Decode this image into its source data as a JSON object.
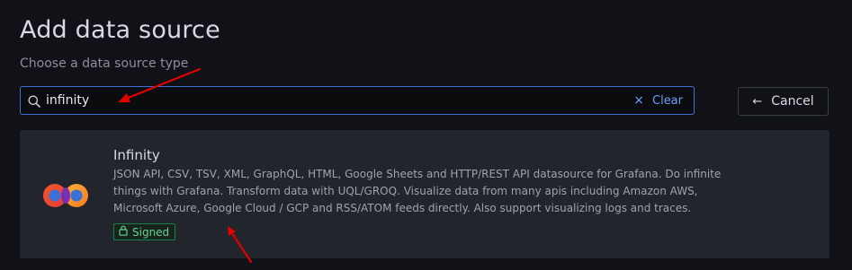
{
  "header": {
    "title": "Add data source",
    "subtitle": "Choose a data source type"
  },
  "search": {
    "value": "infinity",
    "clear_label": "Clear",
    "clear_icon": "×",
    "icon": "search-icon"
  },
  "cancel": {
    "label": "Cancel",
    "icon": "←"
  },
  "results": [
    {
      "name": "Infinity",
      "description": "JSON API, CSV, TSV, XML, GraphQL, HTML, Google Sheets and HTTP/REST API datasource for Grafana. Do infinite things with Grafana. Transform data with UQL/GROQ. Visualize data from many apis including Amazon AWS, Microsoft Azure, Google Cloud / GCP and RSS/ATOM feeds directly. Also support visualizing logs and traces.",
      "badge": "Signed",
      "badge_icon": "lock-icon",
      "logo": "infinity-logo"
    }
  ],
  "annotations": {
    "arrow_color": "#e00000"
  },
  "colors": {
    "background": "#111217",
    "card": "#22252b",
    "accent": "#3d71d9",
    "link": "#6e9fff",
    "badge_green": "#6ccf8e"
  }
}
